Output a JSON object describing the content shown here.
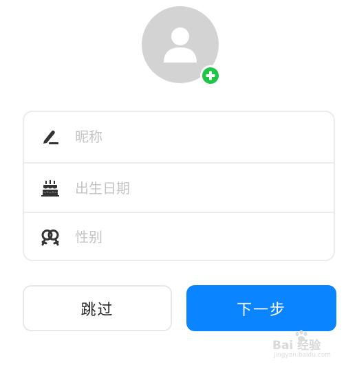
{
  "avatar": {
    "icon": "person-icon",
    "add_icon": "add-circle-icon",
    "add_color": "#20c447",
    "background": "#d3d3d3"
  },
  "form": {
    "nickname": {
      "icon": "pen-icon",
      "placeholder": "昵称",
      "value": ""
    },
    "birthday": {
      "icon": "cake-icon",
      "placeholder": "出生日期",
      "value": ""
    },
    "gender": {
      "icon": "gender-icon",
      "placeholder": "性别",
      "value": ""
    }
  },
  "buttons": {
    "skip_label": "跳过",
    "next_label": "下一步",
    "next_color": "#0a84ff"
  },
  "watermark": {
    "brand": "Bai  经验",
    "url": "jingyan.baidu.com"
  }
}
